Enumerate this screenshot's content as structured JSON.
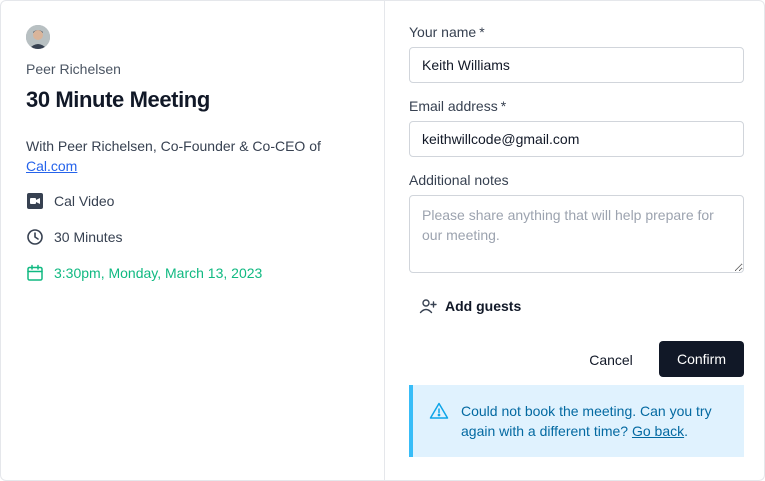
{
  "colors": {
    "primary": "#111827",
    "success": "#10b981",
    "link": "#2563eb",
    "info_bg": "#e0f2fe",
    "info_border": "#38bdf8",
    "info_text": "#0369a1"
  },
  "event": {
    "avatar_icon": "profile-photo",
    "organizer": "Peer Richelsen",
    "title": "30 Minute Meeting",
    "description_prefix": "With Peer Richelsen, Co-Founder & Co-CEO of",
    "description_link": "Cal.com",
    "location": {
      "icon": "video-icon",
      "label": "Cal Video"
    },
    "duration": {
      "icon": "clock-icon",
      "label": "30 Minutes"
    },
    "datetime": {
      "icon": "calendar-icon",
      "label": "3:30pm, Monday, March 13, 2023"
    }
  },
  "form": {
    "name": {
      "label": "Your name",
      "required_mark": "*",
      "value": "Keith Williams"
    },
    "email": {
      "label": "Email address",
      "required_mark": "*",
      "value": "keithwillcode@gmail.com"
    },
    "notes": {
      "label": "Additional notes",
      "placeholder": "Please share anything that will help prepare for our meeting.",
      "value": ""
    },
    "add_guests": {
      "icon": "user-plus-icon",
      "label": "Add guests"
    },
    "cancel_label": "Cancel",
    "confirm_label": "Confirm"
  },
  "alert": {
    "icon": "warning-triangle-icon",
    "message": "Could not book the meeting. Can you try again with a different time?",
    "link_label": "Go back",
    "suffix": "."
  }
}
